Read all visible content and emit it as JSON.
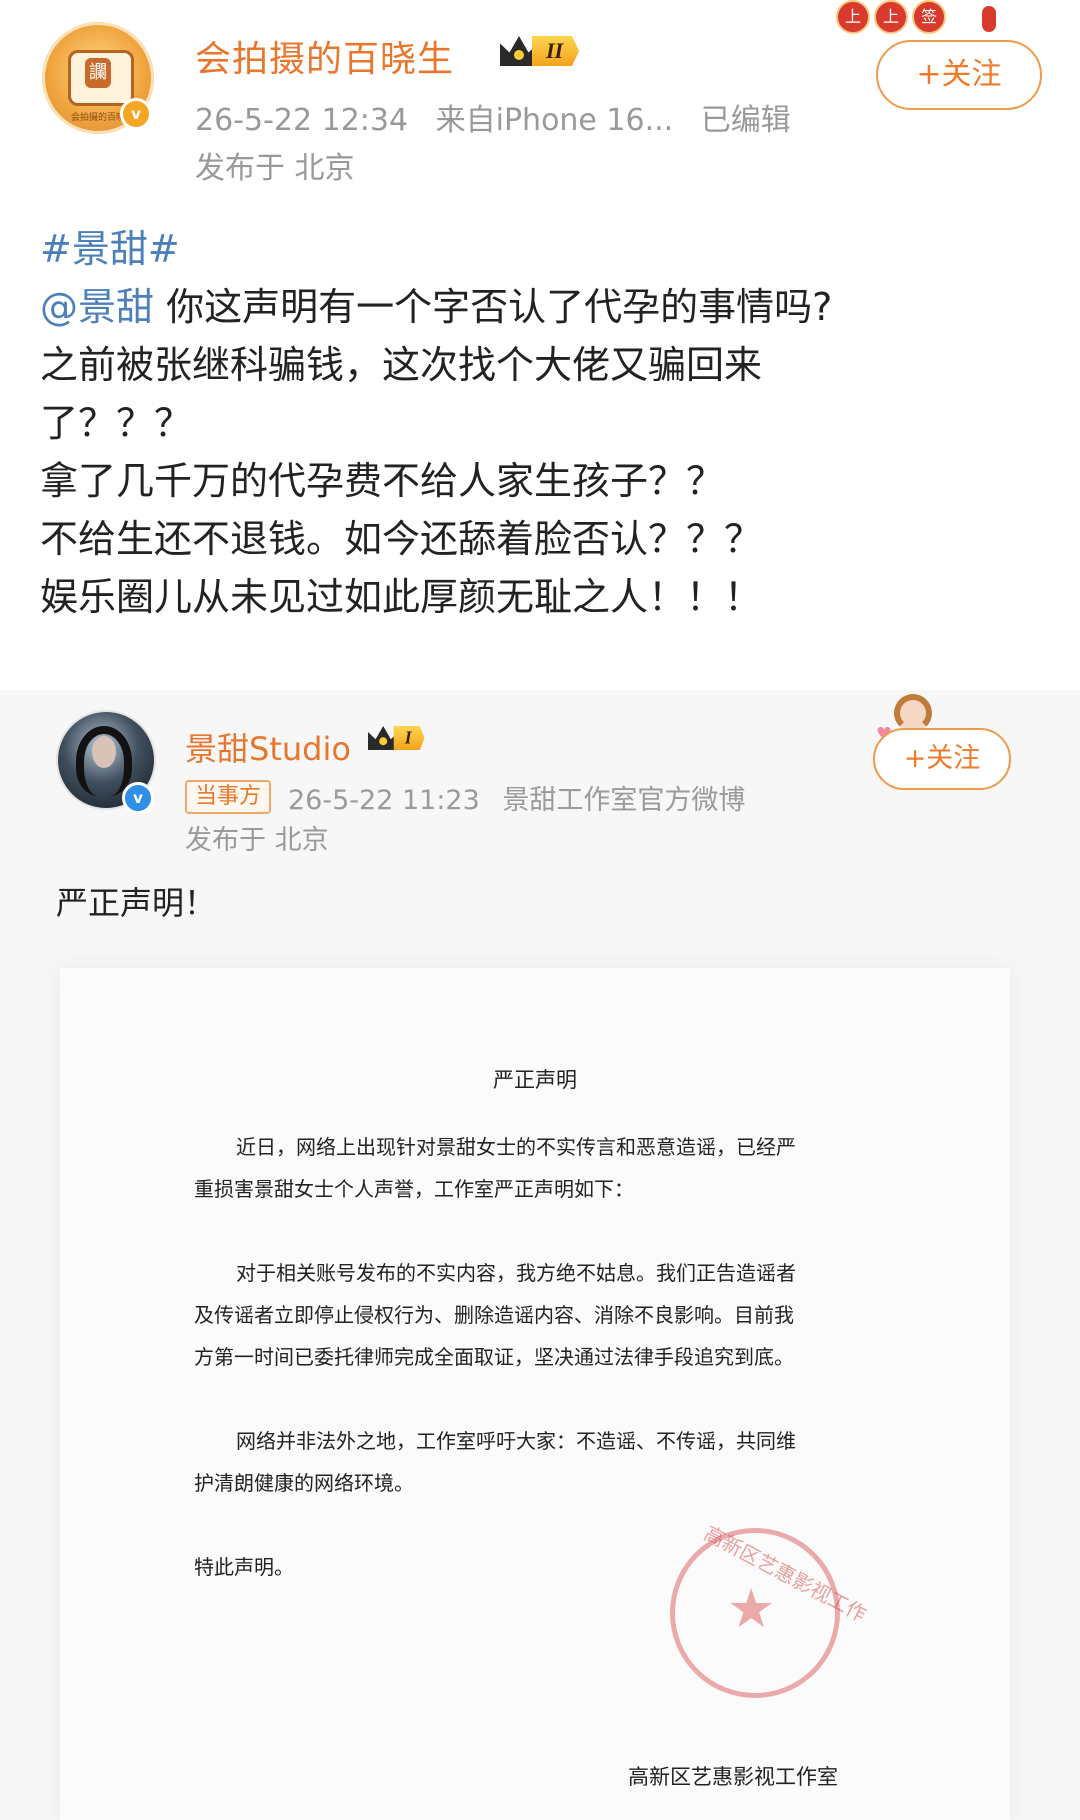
{
  "post": {
    "author_name": "会拍摄的百晓生",
    "level": "II",
    "timestamp": "26-5-22 12:34",
    "source": "来自iPhone 16...",
    "edited": "已编辑",
    "location": "发布于 北京",
    "follow_label": "+关注",
    "avatar_caption": "会拍摄的百晓",
    "body": {
      "hashtag": "#景甜#",
      "mention": "@景甜",
      "line1_rest": " 你这声明有一个字否认了代孕的事情吗?",
      "line2": "之前被张继科骗钱，这次找个大佬又骗回来",
      "line3": "了？？？",
      "line4": "拿了几千万的代孕费不给人家生孩子？？",
      "line5": "不给生还不退钱。如今还舔着脸否认？？？",
      "line6": "娱乐圈儿从未见过如此厚颜无耻之人！！！"
    },
    "decor_stickers": [
      "上",
      "上",
      "签"
    ]
  },
  "quoted": {
    "author_name": "景甜Studio",
    "level": "I",
    "party_tag": "当事方",
    "timestamp": "26-5-22 11:23",
    "source": "景甜工作室官方微博",
    "location": "发布于 北京",
    "follow_label": "+关注",
    "text": "严正声明！",
    "document": {
      "title": "严正声明",
      "para1": [
        "近日，网络上出现针对景甜女士的不实传言和恶意造谣，已经严",
        "重损害景甜女士个人声誉，工作室严正声明如下："
      ],
      "para2": [
        "对于相关账号发布的不实内容，我方绝不姑息。我们正告造谣者",
        "及传谣者立即停止侵权行为、删除造谣内容、消除不良影响。目前我",
        "方第一时间已委托律师完成全面取证，坚决通过法律手段追究到底。"
      ],
      "para3": [
        "网络并非法外之地，工作室呼吁大家：不造谣、不传谣，共同维",
        "护清朗健康的网络环境。"
      ],
      "para4": "特此声明。",
      "signature": "高新区艺惠影视工作室",
      "stamp_text": "高新区艺惠影视工作"
    }
  },
  "colors": {
    "accent_orange": "#e8762c",
    "link_blue": "#4d7fb8",
    "meta_gray": "#999999"
  }
}
